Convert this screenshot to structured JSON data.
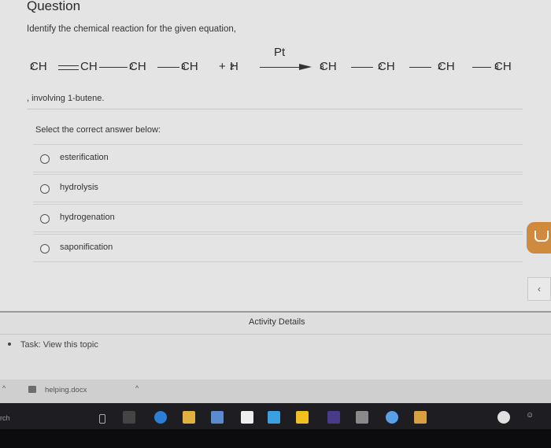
{
  "question": {
    "title": "Question",
    "prompt": "Identify the chemical reaction for the given equation,",
    "equation": {
      "reactant1": [
        "CH",
        "2",
        "CH",
        "CH",
        "2",
        "CH",
        "3"
      ],
      "plus": "+",
      "reactant2_main": "H",
      "reactant2_sub": "2",
      "catalyst": "Pt",
      "product": [
        "CH",
        "3",
        "CH",
        "2",
        "CH",
        "2",
        "CH",
        "3"
      ]
    },
    "involving": ", involving 1-butene.",
    "select_label": "Select the correct answer below:",
    "options": [
      "esterification",
      "hydrolysis",
      "hydrogenation",
      "saponification"
    ]
  },
  "activity": {
    "title": "Activity Details",
    "task": "Task: View this topic"
  },
  "download": {
    "filename": "helping.docx"
  },
  "taskbar": {
    "search_fragment": "rch"
  },
  "colors": {
    "side_button": "#d08a3e",
    "taskbar": "#1e1e22"
  }
}
